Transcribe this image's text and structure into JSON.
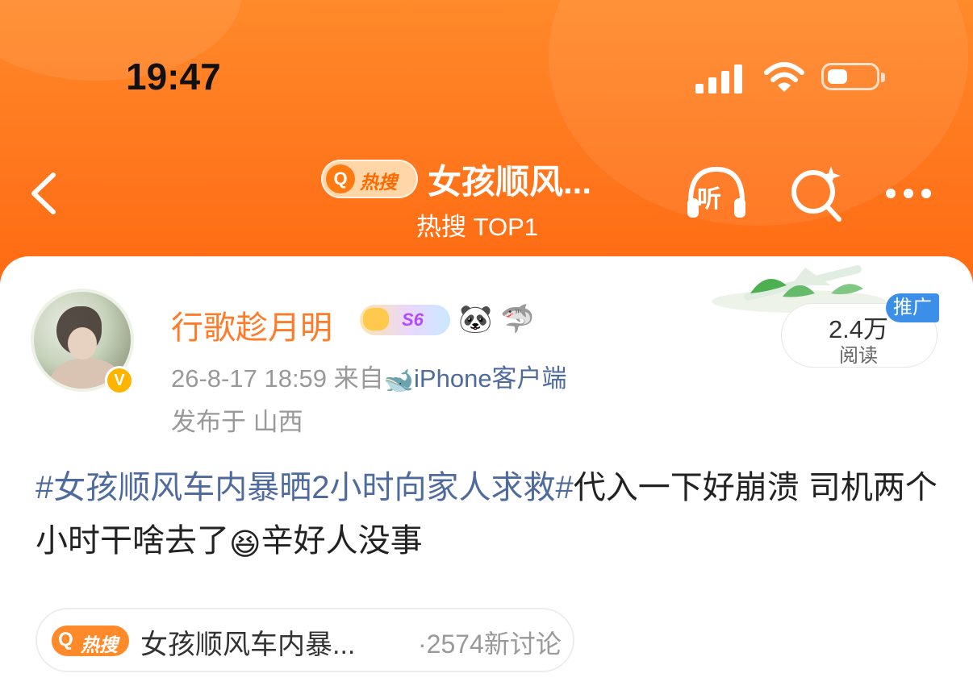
{
  "status_bar": {
    "time": "19:47"
  },
  "header": {
    "hot_tag": "热搜",
    "title": "女孩顺风...",
    "subtitle": "热搜 TOP1",
    "listen_label": "听"
  },
  "post": {
    "username": "行歌趁月明",
    "level": "S6",
    "timestamp": "26-8-17 18:59",
    "source_prefix": "来自",
    "source_client": "iPhone客户端",
    "location": "发布于 山西",
    "reads_count": "2.4万",
    "reads_label": "阅读",
    "promo_label": "推广",
    "hashtag": "#女孩顺风车内暴晒2小时向家人求救#",
    "text_part1": "代入一下好崩溃 司机两个小时干啥去了",
    "text_part2": "辛好人没事"
  },
  "hot_chip": {
    "tag": "热搜",
    "title": "女孩顺风车内暴...",
    "count": "·2574新讨论"
  },
  "colors": {
    "header_orange": "#ff7a1f",
    "username_orange": "#ff7b28",
    "link_blue": "#4f6b9e",
    "promo_blue": "#3b8fe8"
  },
  "icons": [
    "back-arrow-icon",
    "listen-headphone-icon",
    "search-sparkle-icon",
    "more-dots-icon",
    "verified-v-icon",
    "panda-icon",
    "shark-icon",
    "whale-icon",
    "squint-emoji-icon",
    "signal-icon",
    "wifi-icon",
    "battery-icon"
  ]
}
